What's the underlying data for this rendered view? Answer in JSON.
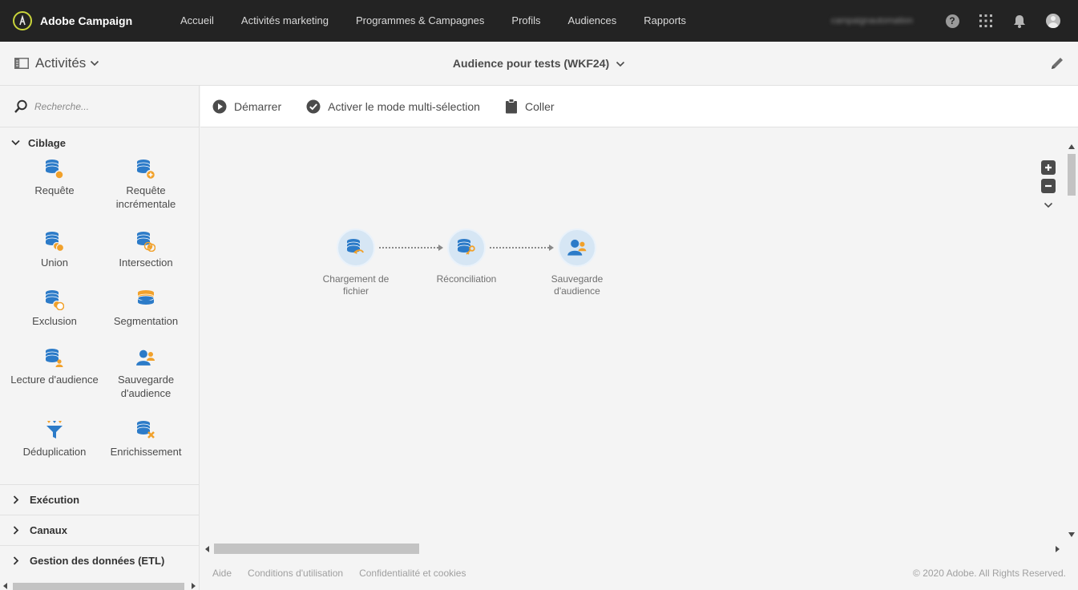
{
  "app": {
    "name": "Adobe Campaign",
    "logo_icon": "adobe-campaign-logo"
  },
  "nav": {
    "items": [
      "Accueil",
      "Activités marketing",
      "Programmes & Campagnes",
      "Profils",
      "Audiences",
      "Rapports"
    ],
    "user_name": "campaignautomation"
  },
  "subbar": {
    "activities_label": "Activités",
    "workflow_title": "Audience pour tests (WKF24)"
  },
  "sidebar": {
    "search_placeholder": "Recherche...",
    "sections": [
      {
        "label": "Ciblage",
        "expanded": true,
        "items": [
          {
            "label": "Requête",
            "icon": "query-icon"
          },
          {
            "label": "Requête incrémentale",
            "icon": "incremental-query-icon"
          },
          {
            "label": "Union",
            "icon": "union-icon"
          },
          {
            "label": "Intersection",
            "icon": "intersection-icon"
          },
          {
            "label": "Exclusion",
            "icon": "exclusion-icon"
          },
          {
            "label": "Segmentation",
            "icon": "segmentation-icon"
          },
          {
            "label": "Lecture d'audience",
            "icon": "read-audience-icon"
          },
          {
            "label": "Sauvegarde d'audience",
            "icon": "save-audience-icon"
          },
          {
            "label": "Déduplication",
            "icon": "deduplication-icon"
          },
          {
            "label": "Enrichissement",
            "icon": "enrichment-icon"
          }
        ]
      },
      {
        "label": "Exécution",
        "expanded": false
      },
      {
        "label": "Canaux",
        "expanded": false
      },
      {
        "label": "Gestion des données (ETL)",
        "expanded": false
      }
    ]
  },
  "toolbar": {
    "start_label": "Démarrer",
    "multiselect_label": "Activer le mode multi-sélection",
    "paste_label": "Coller"
  },
  "workflow": {
    "nodes": [
      {
        "label": "Chargement de fichier",
        "icon": "file-load-icon"
      },
      {
        "label": "Réconciliation",
        "icon": "reconciliation-icon"
      },
      {
        "label": "Sauvegarde d'audience",
        "icon": "save-audience-icon"
      }
    ]
  },
  "footer": {
    "links": [
      "Aide",
      "Conditions d'utilisation",
      "Confidentialité et cookies"
    ],
    "copyright": "© 2020 Adobe. All Rights Reserved."
  },
  "colors": {
    "topbar": "#232323",
    "accent_blue": "#2c7bc8",
    "accent_orange": "#f1a12b",
    "node_bg": "#d6e6f4"
  }
}
